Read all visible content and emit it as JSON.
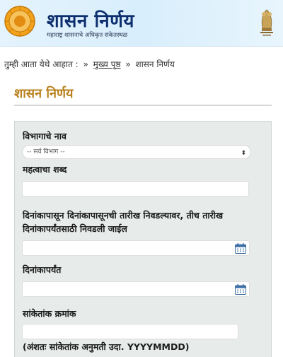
{
  "header": {
    "title": "शासन निर्णय",
    "subtitle": "महाराष्ट्र शासनाचे अधिकृत संकेतस्थळ",
    "colors": {
      "title": "#0d2f6e",
      "banner": "#e4f3fd",
      "emblem": "#f2a31b"
    }
  },
  "breadcrumb": {
    "prefix": "तुम्ही आता येथे आहात :",
    "sep1": "»",
    "home": "मुख्य पृष्ठ",
    "sep2": "»",
    "current": "शासन निर्णय"
  },
  "section": {
    "title": "शासन निर्णय",
    "color": "#b9801b"
  },
  "form": {
    "department_label": "विभागाचे नाव",
    "department_value": "-- सर्व विभाग --",
    "keyword_label": "महत्वाचा शब्द",
    "keyword_value": "",
    "from_date_label_line1": "दिनांकापासून दिनांकापासूनची तारीख निवडल्यावर, तीच तारीख",
    "from_date_label_line2": "दिनांकापर्यंतसाठी निवडली जाईल",
    "from_date_value": "",
    "to_date_label": "दिनांकापर्यंत",
    "to_date_value": "",
    "code_label": "सांकेतांक क्रमांक",
    "code_value": "",
    "code_hint": "(अंशतः सांकेतांक अनुमती उदा. YYYYMMDD)"
  },
  "icons": {
    "emblem": "maharashtra-seal-icon",
    "ashoka": "ashoka-emblem-icon",
    "calendar": "calendar-icon",
    "dropdown": "chevron-updown-icon"
  }
}
